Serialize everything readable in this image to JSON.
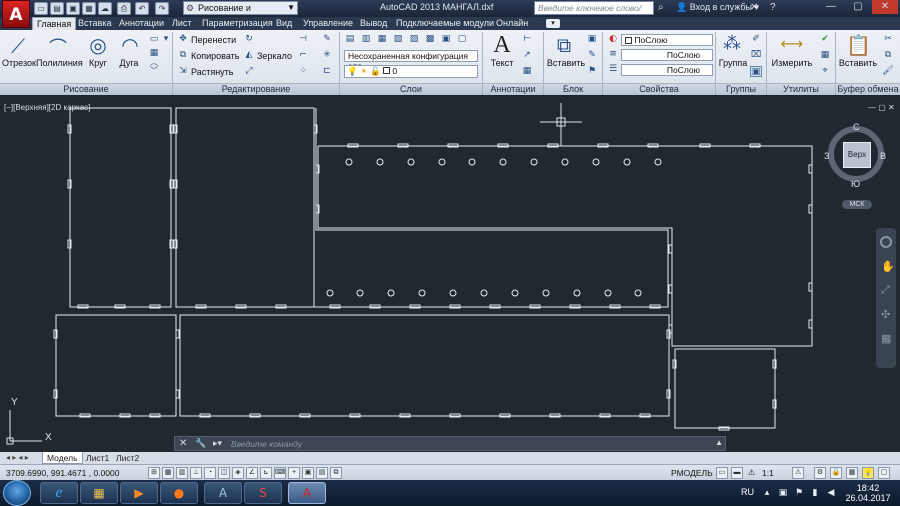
{
  "titlebar": {
    "logo_letter": "A",
    "workspace": "Рисование и аннотации",
    "doc_title": "AutoCAD 2013    МАНГАЛ.dxf",
    "search_placeholder": "Введите ключевое слово/фразу",
    "sign_in": "Вход в службы",
    "minimize": "—",
    "maximize": "▢",
    "close": "✕"
  },
  "tabs": [
    {
      "label": "Главная",
      "active": true
    },
    {
      "label": "Вставка"
    },
    {
      "label": "Аннотации"
    },
    {
      "label": "Лист"
    },
    {
      "label": "Параметризация"
    },
    {
      "label": "Вид"
    },
    {
      "label": "Управление"
    },
    {
      "label": "Вывод"
    },
    {
      "label": "Подключаемые модули"
    },
    {
      "label": "Онлайн"
    }
  ],
  "ribbon": {
    "draw": {
      "title": "Рисование",
      "line": "Отрезок",
      "polyline": "Полилиния",
      "circle": "Круг",
      "arc": "Дуга"
    },
    "modify": {
      "title": "Редактирование",
      "move": "Перенести",
      "copy": "Копировать",
      "stretch": "Растянуть",
      "mirror": "Зеркало"
    },
    "layers": {
      "title": "Слои",
      "config": "Несохраненная конфигурация сло",
      "current": "0"
    },
    "annotation": {
      "title": "Аннотации",
      "text": "Текст"
    },
    "block": {
      "title": "Блок",
      "insert": "Вставить"
    },
    "properties": {
      "title": "Свойства",
      "color": "ПоСлою",
      "linetype": "ПоСлою",
      "lineweight": "ПоСлою"
    },
    "groups": {
      "title": "Группы",
      "group": "Группа"
    },
    "utilities": {
      "title": "Утилиты",
      "measure": "Измерить"
    },
    "clipboard": {
      "title": "Буфер обмена",
      "paste": "Вставить"
    }
  },
  "viewport": {
    "label": "[−][Верхняя][2D каркас]"
  },
  "viewcube": {
    "face": "Верх",
    "north": "С",
    "south": "Ю",
    "west": "З",
    "east": "В",
    "ucs": "МСК"
  },
  "ucs_axis": {
    "x": "X",
    "y": "Y"
  },
  "cmdline": {
    "placeholder": "Введите команду"
  },
  "layout_tabs": [
    {
      "label": "Модель",
      "active": true
    },
    {
      "label": "Лист1"
    },
    {
      "label": "Лист2"
    }
  ],
  "status": {
    "coords": "3709.6990, 991.4671 , 0.0000",
    "model": "РМОДЕЛЬ",
    "scale": "1:1"
  },
  "taskbar": {
    "lang": "RU",
    "time": "18:42",
    "date": "26.04.2017"
  },
  "colors": {
    "canvas": "#212830",
    "lines": "#e8ecf2",
    "ribbon": "#e4e9f0"
  }
}
